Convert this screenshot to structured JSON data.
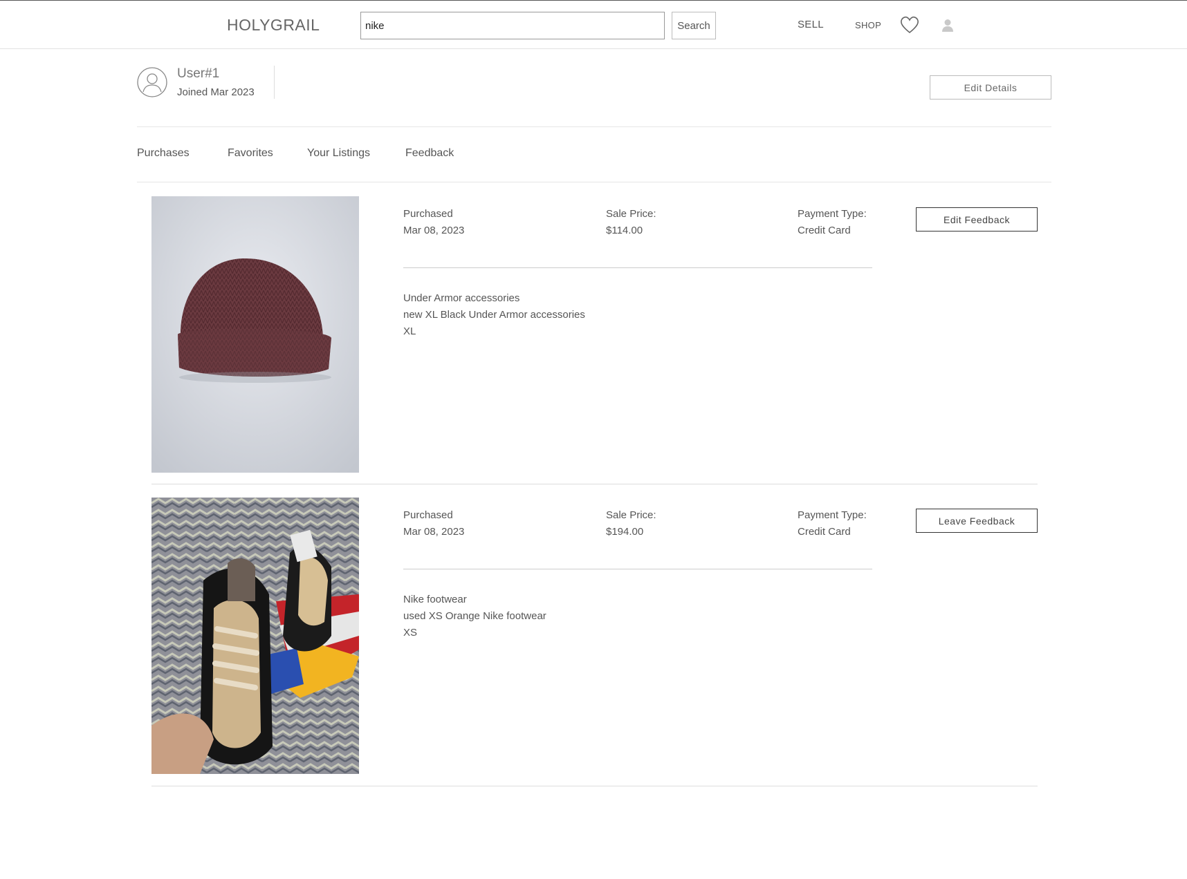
{
  "header": {
    "logo": "HOLYGRAIL",
    "search_value": "nike",
    "search_button": "Search",
    "nav": {
      "sell": "SELL",
      "shop": "SHOP"
    },
    "icons": [
      "heart-icon",
      "user-icon"
    ]
  },
  "profile": {
    "username": "User#1",
    "joined": "Joined Mar 2023",
    "edit_button": "Edit Details"
  },
  "tabs": [
    {
      "label": "Purchases",
      "active": true
    },
    {
      "label": "Favorites"
    },
    {
      "label": "Your Listings"
    },
    {
      "label": "Feedback"
    }
  ],
  "labels": {
    "purchased": "Purchased",
    "sale_price": "Sale Price:",
    "payment_type": "Payment Type:"
  },
  "purchases": [
    {
      "image": "maroon knit beanie",
      "date": "Mar 08, 2023",
      "price": "$114.00",
      "payment": "Credit Card",
      "title": "Under Armor accessories",
      "subtitle": "new XL Black Under Armor accessories",
      "size": "XL",
      "button": "Edit Feedback"
    },
    {
      "image": "sneakers with box",
      "date": "Mar 08, 2023",
      "price": "$194.00",
      "payment": "Credit Card",
      "title": "Nike footwear",
      "subtitle": "used XS Orange Nike footwear",
      "size": "XS",
      "button": "Leave Feedback"
    }
  ]
}
